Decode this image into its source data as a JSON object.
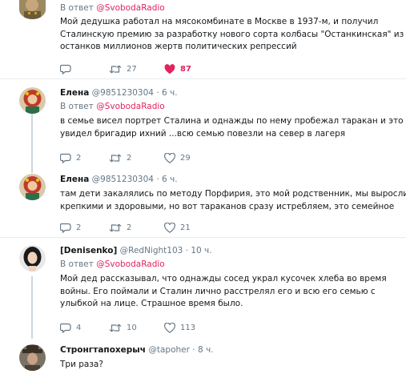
{
  "tweets": [
    {
      "reply_prefix": "В ответ",
      "reply_handle": "@SvobodaRadio",
      "lines": [
        "Мой дедушка работал на мясокомбинате в Москве в 1937-м, и получил",
        "Сталинскую премию за разработку нового сорта колбасы \"Останкинская\" из",
        "останков миллионов жертв политических репрессий"
      ],
      "replies": "",
      "retweets": "27",
      "likes": "87"
    },
    {
      "name": "Елена",
      "handle": "@9851230304",
      "dot": "·",
      "time": "6 ч.",
      "reply_prefix": "В ответ",
      "reply_handle": "@SvobodaRadio",
      "lines": [
        "в семье висел портрет Сталина и однажды по нему пробежал таракан и это",
        "увидел бригадир ихний ...всю семью повезли на север в лагеря"
      ],
      "replies": "2",
      "retweets": "2",
      "likes": "29"
    },
    {
      "name": "Елена",
      "handle": "@9851230304",
      "dot": "·",
      "time": "6 ч.",
      "lines": [
        "там дети закалялись по методу Порфирия, это мой родственник, мы выросли",
        "крепкими и здоровыми, но вот тараканов сразу истребляем, это семейное"
      ],
      "replies": "2",
      "retweets": "2",
      "likes": "21"
    },
    {
      "name": "[Denisenko]",
      "handle": "@RedNight103",
      "dot": "·",
      "time": "10 ч.",
      "reply_prefix": "В ответ",
      "reply_handle": "@SvobodaRadio",
      "lines": [
        "Мой дед рассказывал, что однажды сосед украл кусочек хлеба во время",
        "войны. Его поймали и Сталин лично расстрелял его и всю его семью с",
        "улыбкой на лице. Страшное время было."
      ],
      "replies": "4",
      "retweets": "10",
      "likes": "113"
    },
    {
      "name": "Стронгтапохерыч",
      "handle": "@tapoher",
      "dot": "·",
      "time": "8 ч.",
      "lines": [
        "Три раза?"
      ]
    }
  ],
  "colors": {
    "like_active": "#e0245e",
    "mention": "#e0245e",
    "muted": "#657786",
    "thread_line": "#ccd6dd"
  },
  "icons": [
    "reply-icon",
    "retweet-icon",
    "like-icon"
  ]
}
